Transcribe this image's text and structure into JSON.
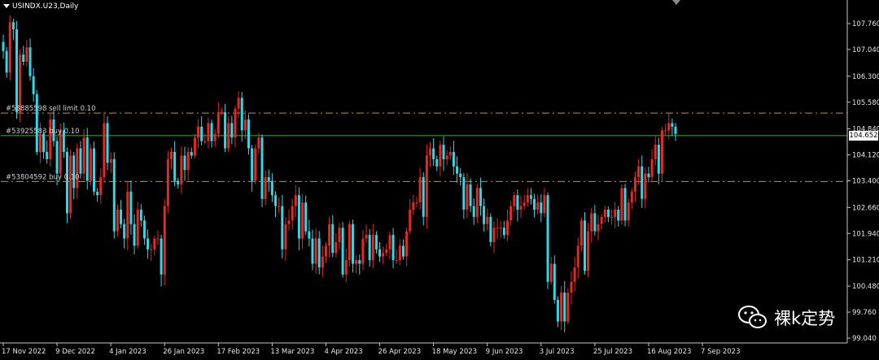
{
  "window": {
    "title": "USINDX.U23,Daily"
  },
  "chart_data": {
    "type": "candlestick",
    "symbol": "USINDX.U23",
    "timeframe": "Daily",
    "y_ticks": [
      "107.760",
      "107.040",
      "106.300",
      "105.580",
      "104.840",
      "104.120",
      "103.400",
      "102.660",
      "101.940",
      "101.210",
      "100.480",
      "99.760",
      "99.040"
    ],
    "x_ticks": [
      "17 Nov 2022",
      "9 Dec 2022",
      "4 Jan 2023",
      "26 Jan 2023",
      "17 Feb 2023",
      "13 Mar 2023",
      "4 Apr 2023",
      "26 Apr 2023",
      "18 May 2023",
      "9 Jun 2023",
      "3 Jul 2023",
      "25 Jul 2023",
      "16 Aug 2023",
      "7 Sep 2023"
    ],
    "ylim": [
      98.9,
      108.2
    ],
    "last_price": "104.652",
    "order_lines": [
      {
        "label": "#53885598 sell limit 0.10",
        "price": 105.28,
        "color": "#d98a2b",
        "style": "dashdot"
      },
      {
        "label": "#53925583 buy 0.10",
        "price": 104.652,
        "color": "#3fae3f",
        "style": "solid"
      },
      {
        "label": "#53804592 buy 0.10",
        "price": 103.38,
        "color": "#d98a2b",
        "style": "dashdot"
      }
    ],
    "up_color": "#e8271f",
    "down_color": "#2fd8e8",
    "grid": false,
    "anchors": [
      [
        0,
        107.0
      ],
      [
        4,
        107.7
      ],
      [
        9,
        106.1
      ],
      [
        14,
        104.8
      ],
      [
        18,
        103.3
      ],
      [
        22,
        104.3
      ],
      [
        27,
        103.0
      ],
      [
        31,
        104.4
      ],
      [
        35,
        102.3
      ],
      [
        39,
        101.7
      ],
      [
        42,
        102.1
      ],
      [
        47,
        101.6
      ],
      [
        52,
        100.8
      ],
      [
        55,
        103.1
      ],
      [
        60,
        104.0
      ],
      [
        65,
        104.8
      ],
      [
        70,
        105.3
      ],
      [
        75,
        105.8
      ],
      [
        78,
        104.8
      ],
      [
        81,
        103.4
      ],
      [
        84,
        104.2
      ],
      [
        87,
        102.8
      ],
      [
        91,
        101.9
      ],
      [
        95,
        101.3
      ],
      [
        98,
        102.1
      ],
      [
        101,
        100.8
      ],
      [
        104,
        101.8
      ],
      [
        108,
        101.6
      ],
      [
        111,
        101.0
      ],
      [
        114,
        102.0
      ],
      [
        118,
        101.3
      ],
      [
        121,
        102.5
      ],
      [
        126,
        103.7
      ],
      [
        131,
        104.4
      ],
      [
        135,
        103.9
      ],
      [
        139,
        103.4
      ],
      [
        143,
        102.4
      ],
      [
        147,
        101.8
      ],
      [
        150,
        102.4
      ],
      [
        154,
        103.0
      ],
      [
        159,
        102.4
      ],
      [
        163,
        100.0
      ],
      [
        165,
        99.2
      ],
      [
        168,
        100.5
      ],
      [
        172,
        101.5
      ],
      [
        176,
        102.4
      ],
      [
        180,
        103.4
      ],
      [
        185,
        103.2
      ],
      [
        189,
        103.6
      ],
      [
        193,
        104.1
      ],
      [
        197,
        104.8
      ],
      [
        199,
        104.98
      ],
      [
        200,
        104.7
      ]
    ],
    "windows": [
      {
        "x0": 0,
        "x1": 48,
        "values": [
          107.0,
          106.4,
          107.8,
          107.6,
          105.3,
          106.9,
          106.7,
          107.1,
          106.3,
          105.8,
          104.2,
          104.7,
          104.2,
          104.0,
          105.1,
          104.5,
          103.6,
          104.8,
          104.2,
          102.5,
          104.1,
          103.2,
          104.3,
          103.6,
          104.6,
          103.4,
          104.3,
          103.1,
          103.0,
          103.5,
          105.0,
          103.9,
          104.0,
          102.0,
          102.6,
          102.2,
          101.8,
          103.1,
          102.2,
          101.6,
          102.6,
          102.3,
          101.8,
          101.5,
          101.5,
          101.8,
          101.8,
          100.8
        ]
      },
      {
        "x0": 48,
        "x1": 96,
        "values": [
          102.7,
          104.0,
          104.2,
          103.4,
          103.3,
          104.1,
          103.7,
          104.2,
          104.1,
          104.6,
          104.9,
          104.5,
          104.5,
          105.0,
          104.5,
          104.7,
          105.3,
          105.3,
          104.3,
          105.0,
          104.6,
          105.4,
          105.7,
          104.8,
          105.1,
          104.3,
          103.4,
          104.3,
          104.6,
          102.9,
          103.5,
          103.4,
          103.0,
          102.7,
          102.7,
          101.5,
          102.2,
          102.3,
          102.7,
          103.0,
          101.8,
          102.8,
          102.0,
          101.8,
          101.1,
          101.8,
          101.0,
          101.3
        ]
      },
      {
        "x0": 96,
        "x1": 144,
        "values": [
          101.6,
          102.2,
          101.4,
          101.7,
          102.1,
          100.8,
          101.2,
          102.2,
          101.1,
          101.2,
          101.1,
          101.8,
          101.9,
          101.2,
          101.9,
          101.5,
          101.3,
          101.4,
          101.5,
          101.9,
          101.2,
          101.2,
          101.6,
          101.3,
          102.0,
          102.6,
          102.8,
          102.8,
          103.5,
          102.4,
          104.1,
          104.3,
          104.0,
          103.8,
          104.4,
          104.0,
          104.1,
          104.2,
          103.8,
          103.6,
          103.5,
          102.6,
          103.3,
          102.7,
          102.4,
          103.2,
          102.7,
          102.2
        ]
      },
      {
        "x0": 144,
        "x1": 200,
        "values": [
          102.4,
          101.7,
          102.1,
          102.1,
          102.1,
          101.9,
          102.3,
          102.7,
          103.0,
          102.6,
          102.7,
          102.8,
          103.0,
          102.9,
          102.6,
          102.8,
          102.5,
          103.0,
          100.6,
          101.1,
          100.1,
          99.5,
          100.3,
          99.5,
          100.3,
          100.6,
          101.0,
          101.6,
          102.3,
          100.9,
          102.0,
          102.5,
          102.0,
          102.2,
          102.4,
          102.6,
          102.4,
          102.4,
          102.6,
          102.3,
          103.2,
          102.3,
          102.8,
          103.1,
          103.5,
          103.8,
          102.9,
          103.6,
          103.5,
          104.0,
          104.4,
          103.6,
          104.8,
          104.8,
          105.0,
          104.9
        ]
      }
    ]
  },
  "watermark": {
    "brand_text": "裸k定势"
  }
}
